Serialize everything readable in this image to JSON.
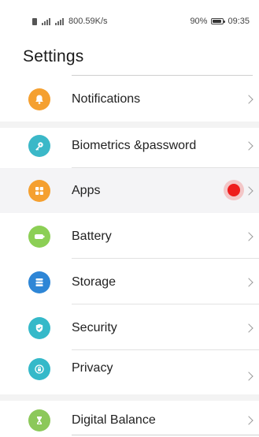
{
  "status_bar": {
    "network_speed": "800.59K/s",
    "battery_percent": "90%",
    "time": "09:35"
  },
  "page_title": "Settings",
  "colors": {
    "notifications": "#f5a030",
    "biometrics": "#3bb8c8",
    "apps": "#f5a030",
    "battery": "#8ccf55",
    "storage": "#2e86d6",
    "security": "#35b9c9",
    "privacy": "#35b9c9",
    "digital_balance": "#8cc85a",
    "tap_marker": "#ee1c1c"
  },
  "items": [
    {
      "label": "Notifications",
      "icon": "bell-icon"
    },
    {
      "label": "Biometrics &password",
      "icon": "key-icon"
    },
    {
      "label": "Apps",
      "icon": "apps-grid-icon"
    },
    {
      "label": "Battery",
      "icon": "battery-icon"
    },
    {
      "label": "Storage",
      "icon": "storage-icon"
    },
    {
      "label": "Security",
      "icon": "shield-icon"
    },
    {
      "label": "Privacy",
      "icon": "privacy-lock-icon"
    },
    {
      "label": "Digital Balance",
      "icon": "hourglass-icon"
    }
  ]
}
